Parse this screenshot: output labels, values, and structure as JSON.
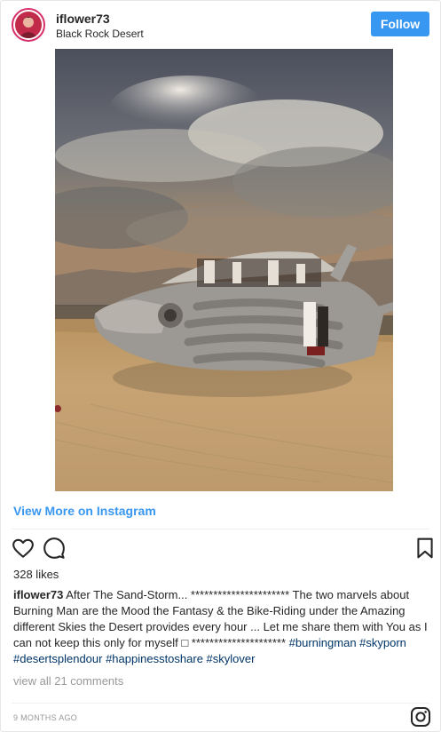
{
  "header": {
    "username": "iflower73",
    "location": "Black Rock Desert",
    "follow_label": "Follow"
  },
  "photo": {
    "subject": "desert-art-car-photo"
  },
  "view_more_label": "View More on Instagram",
  "actions": {
    "like_icon": "heart-icon",
    "comment_icon": "comment-icon",
    "save_icon": "bookmark-icon"
  },
  "likes_text": "328 likes",
  "caption": {
    "username": "iflower73",
    "text": "After The Sand-Storm... ********************** The two marvels about Burning Man are the Mood the Fantasy & the Bike-Riding under the Amazing different Skies the Desert provides every hour ... Let me share them with You as I can not keep this only for myself □ *********************",
    "hashtags": "#burningman #skyporn #desertsplendour #happinesstoshare #skylover"
  },
  "comments_link": "view all 21 comments",
  "timestamp": "9 MONTHS AGO",
  "colors": {
    "accent": "#3897f0",
    "hashtag": "#003569",
    "muted": "#999999",
    "text": "#262626"
  }
}
